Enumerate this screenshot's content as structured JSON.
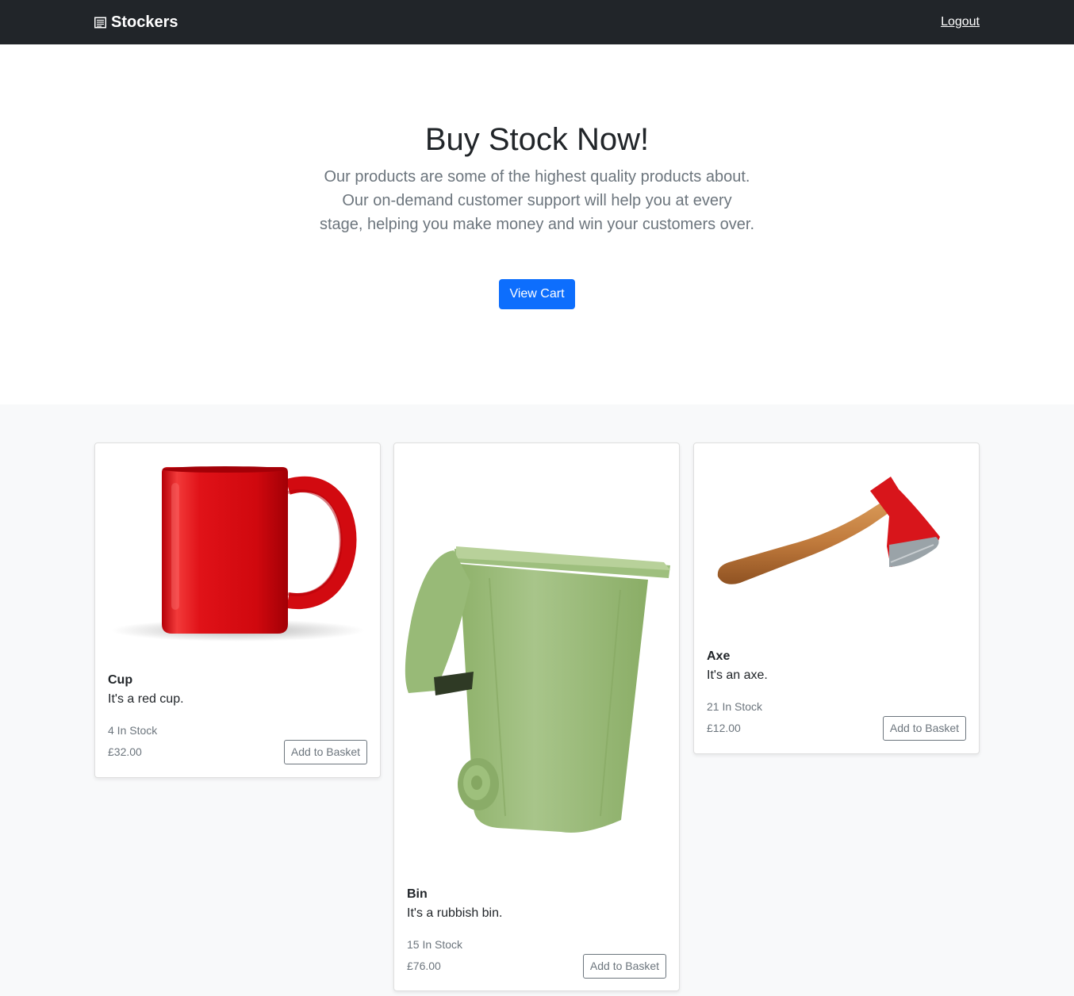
{
  "navbar": {
    "brand": "Stockers",
    "brand_icon": "newspaper-icon",
    "logout_label": "Logout"
  },
  "hero": {
    "title": "Buy Stock Now!",
    "lead": "Our products are some of the highest quality products about. Our on-demand customer support will help you at every stage, helping you make money and win your customers over.",
    "button_label": "View Cart",
    "button_color": "#0d6efd"
  },
  "products": [
    {
      "image": "red-mug-image",
      "name": "Cup",
      "description": "It's a red cup.",
      "stock": "4 In Stock",
      "price": "£32.00",
      "button_label": "Add to Basket"
    },
    {
      "image": "green-wheelie-bin-image",
      "name": "Bin",
      "description": "It's a rubbish bin.",
      "stock": "15 In Stock",
      "price": "£76.00",
      "button_label": "Add to Basket"
    },
    {
      "image": "axe-image",
      "name": "Axe",
      "description": "It's an axe.",
      "stock": "21 In Stock",
      "price": "£12.00",
      "button_label": "Add to Basket"
    }
  ]
}
